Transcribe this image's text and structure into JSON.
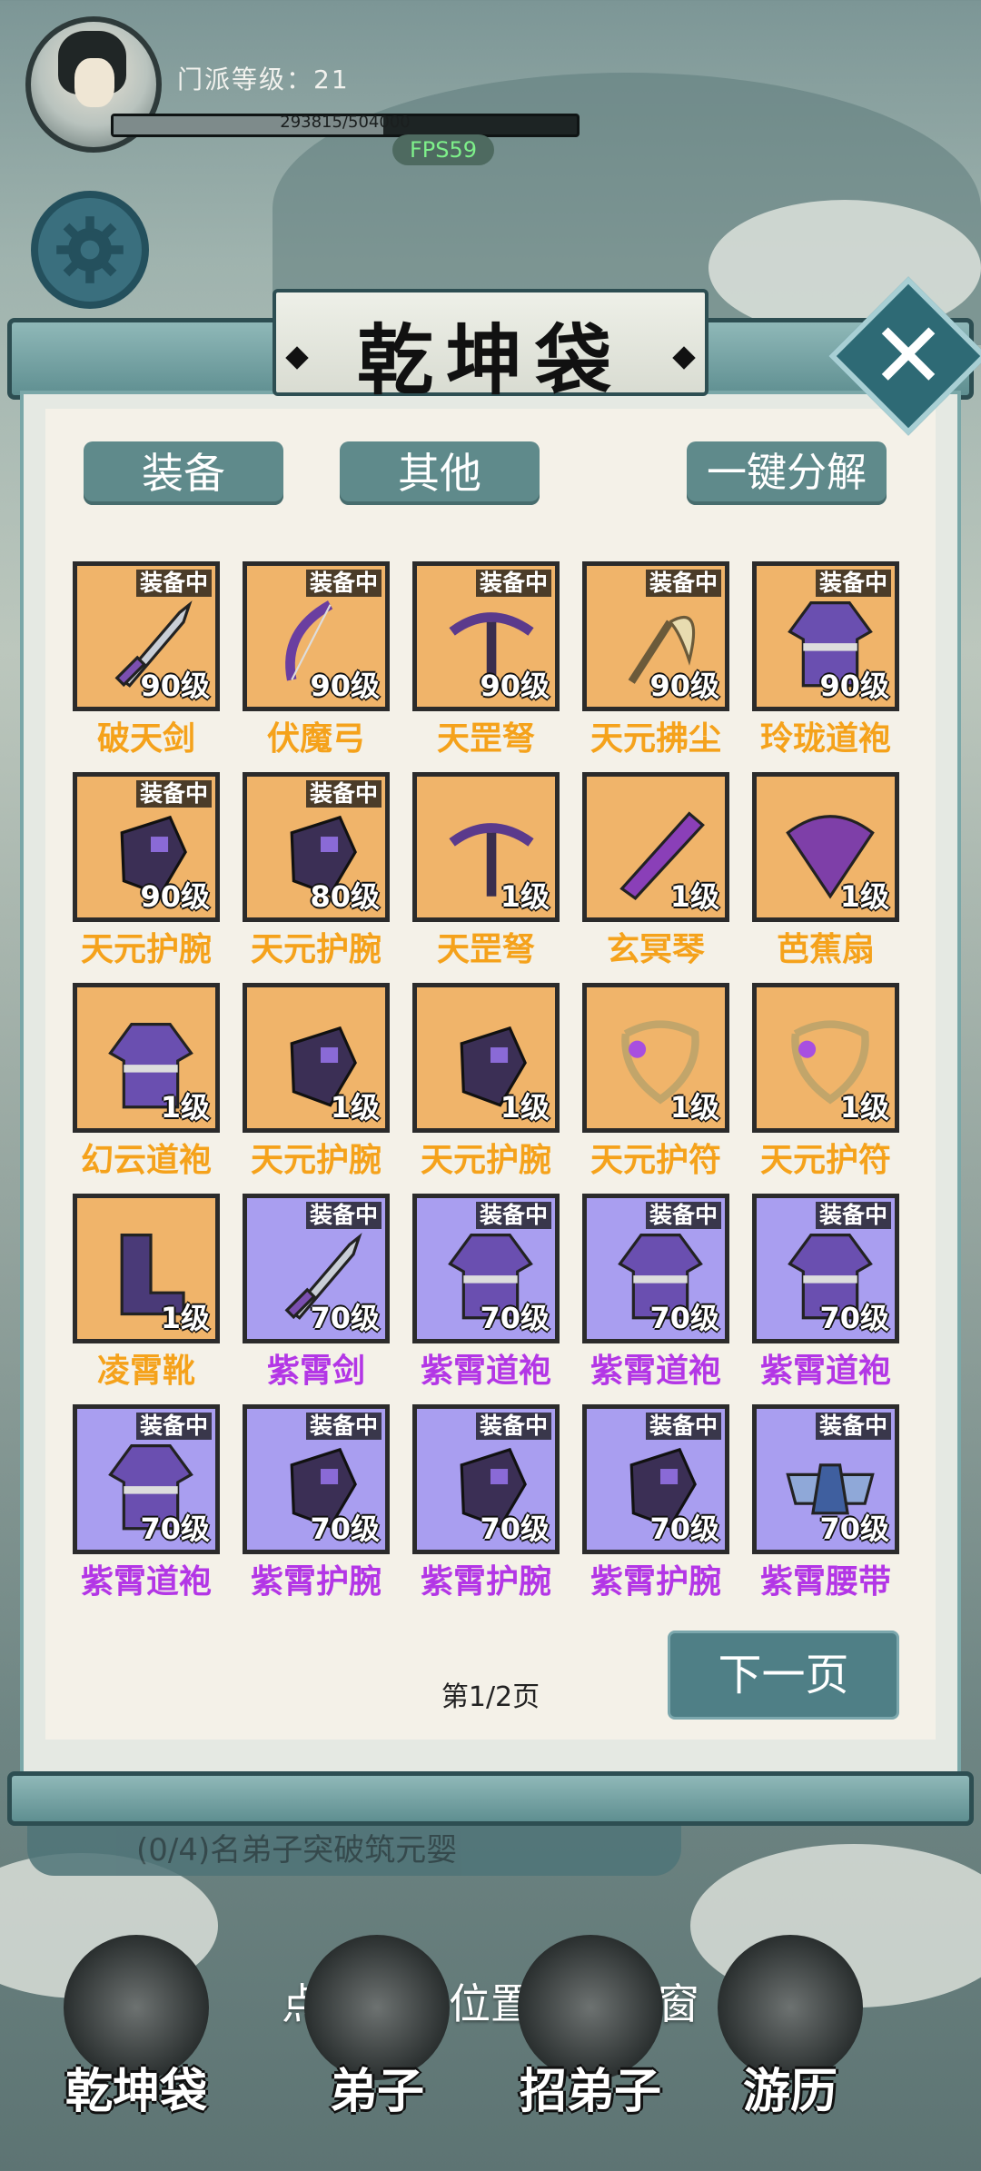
{
  "hud": {
    "sect_level_label": "门派等级：21",
    "exp_text": "293815/504000",
    "exp_progress": 0.583,
    "fps": "FPS59"
  },
  "panel": {
    "title": "乾坤袋",
    "close_label": "✕",
    "tabs": [
      "装备",
      "其他",
      "一键分解"
    ],
    "items": [
      {
        "name": "破天剑",
        "level": "90级",
        "equipped": true,
        "rarity": "orange",
        "icon": "sword-icon"
      },
      {
        "name": "伏魔弓",
        "level": "90级",
        "equipped": true,
        "rarity": "orange",
        "icon": "bow-icon"
      },
      {
        "name": "天罡弩",
        "level": "90级",
        "equipped": true,
        "rarity": "orange",
        "icon": "crossbow-icon"
      },
      {
        "name": "天元拂尘",
        "level": "90级",
        "equipped": true,
        "rarity": "orange",
        "icon": "whisk-icon"
      },
      {
        "name": "玲珑道袍",
        "level": "90级",
        "equipped": true,
        "rarity": "orange",
        "icon": "robe-icon"
      },
      {
        "name": "天元护腕",
        "level": "90级",
        "equipped": true,
        "rarity": "orange",
        "icon": "gauntlet-icon"
      },
      {
        "name": "天元护腕",
        "level": "80级",
        "equipped": true,
        "rarity": "orange",
        "icon": "gauntlet-icon"
      },
      {
        "name": "天罡弩",
        "level": "1级",
        "equipped": false,
        "rarity": "orange",
        "icon": "crossbow-icon"
      },
      {
        "name": "玄冥琴",
        "level": "1级",
        "equipped": false,
        "rarity": "orange",
        "icon": "zither-icon"
      },
      {
        "name": "芭蕉扇",
        "level": "1级",
        "equipped": false,
        "rarity": "orange",
        "icon": "fan-icon"
      },
      {
        "name": "幻云道袍",
        "level": "1级",
        "equipped": false,
        "rarity": "orange",
        "icon": "robe-icon"
      },
      {
        "name": "天元护腕",
        "level": "1级",
        "equipped": false,
        "rarity": "orange",
        "icon": "gauntlet-icon"
      },
      {
        "name": "天元护腕",
        "level": "1级",
        "equipped": false,
        "rarity": "orange",
        "icon": "gauntlet-icon"
      },
      {
        "name": "天元护符",
        "level": "1级",
        "equipped": false,
        "rarity": "orange",
        "icon": "amulet-icon"
      },
      {
        "name": "天元护符",
        "level": "1级",
        "equipped": false,
        "rarity": "orange",
        "icon": "amulet-icon"
      },
      {
        "name": "凌霄靴",
        "level": "1级",
        "equipped": false,
        "rarity": "orange",
        "icon": "boots-icon"
      },
      {
        "name": "紫霄剑",
        "level": "70级",
        "equipped": true,
        "rarity": "purple",
        "icon": "sword-icon"
      },
      {
        "name": "紫霄道袍",
        "level": "70级",
        "equipped": true,
        "rarity": "purple",
        "icon": "robe-icon"
      },
      {
        "name": "紫霄道袍",
        "level": "70级",
        "equipped": true,
        "rarity": "purple",
        "icon": "robe-icon"
      },
      {
        "name": "紫霄道袍",
        "level": "70级",
        "equipped": true,
        "rarity": "purple",
        "icon": "robe-icon"
      },
      {
        "name": "紫霄道袍",
        "level": "70级",
        "equipped": true,
        "rarity": "purple",
        "icon": "robe-icon"
      },
      {
        "name": "紫霄护腕",
        "level": "70级",
        "equipped": true,
        "rarity": "purple",
        "icon": "gauntlet-icon"
      },
      {
        "name": "紫霄护腕",
        "level": "70级",
        "equipped": true,
        "rarity": "purple",
        "icon": "gauntlet-icon"
      },
      {
        "name": "紫霄护腕",
        "level": "70级",
        "equipped": true,
        "rarity": "purple",
        "icon": "gauntlet-icon"
      },
      {
        "name": "紫霄腰带",
        "level": "70级",
        "equipped": true,
        "rarity": "purple",
        "icon": "belt-icon"
      }
    ],
    "equipped_badge": "装备中",
    "page_indicator": "第1/2页",
    "next_page_label": "下一页"
  },
  "background": {
    "quest_banner": "(0/4)名弟子突破筑元婴"
  },
  "hint": "点击空白位置关闭弹窗",
  "nav": [
    "乾坤袋",
    "弟子",
    "招弟子",
    "游历"
  ],
  "colors": {
    "orange_frame": "#f0b46a",
    "purple_frame": "#a99ef0",
    "orange_name": "#f5a21b",
    "purple_name": "#b336e6",
    "fps_text": "#7ef08a"
  }
}
